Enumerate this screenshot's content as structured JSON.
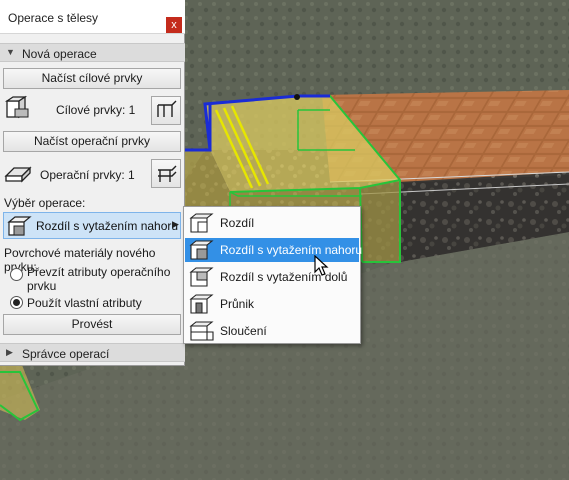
{
  "window": {
    "title": "Operace s tělesy",
    "close_glyph": "x"
  },
  "sections": {
    "new_operation": "Nová operace",
    "operation_manager": "Správce operací"
  },
  "buttons": {
    "load_target": "Načíst cílové prvky",
    "load_operator": "Načíst operační prvky",
    "execute": "Provést"
  },
  "counts": {
    "target_label": "Cílové prvky: 1",
    "operator_label": "Operační prvky: 1"
  },
  "operation_select": {
    "label": "Výběr operace:",
    "selected": "Rozdíl s vytažením nahoru"
  },
  "surface": {
    "label": "Povrchové materiály nového prvku:",
    "option_1": "Převzít atributy operačního prvku",
    "option_2": "Použít vlastní atributy",
    "selected_option": 2
  },
  "menu": {
    "items": [
      "Rozdíl",
      "Rozdíl s vytažením nahoru",
      "Rozdíl s vytažením dolů",
      "Průnik",
      "Sloučení"
    ],
    "highlighted_index": 1
  },
  "colors": {
    "accent_highlight": "#3390e6",
    "select_bg": "#cde3f7",
    "close_red": "#c42b1c",
    "selection_green": "#27c43a",
    "selection_yellow": "#e6e600",
    "edge_blue": "#1a2cd6"
  },
  "icons": {
    "target": "target-elements-icon",
    "operator": "operator-elements-icon",
    "pick": "pick-elements-icon",
    "cursor": "mouse-cursor-icon"
  }
}
